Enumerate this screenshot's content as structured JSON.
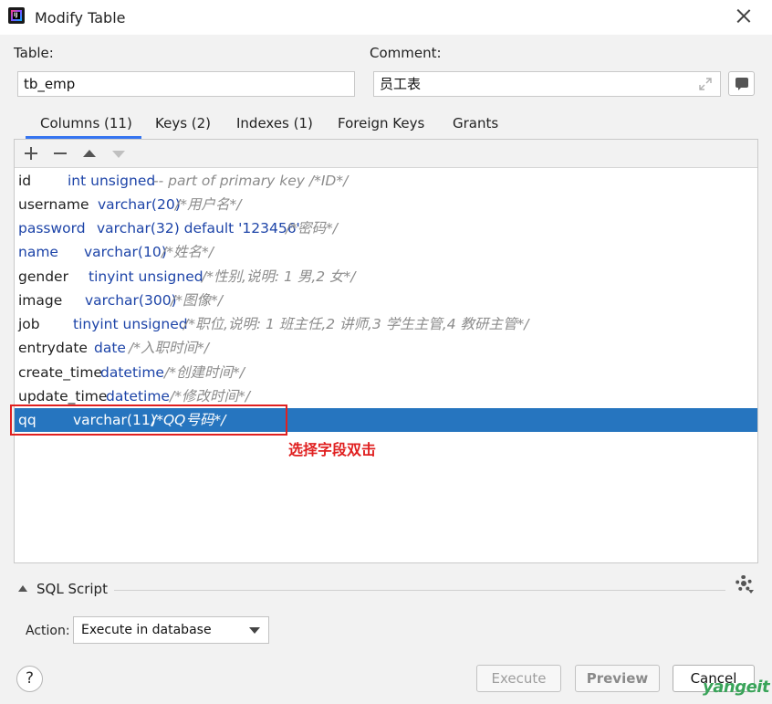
{
  "window": {
    "title": "Modify Table"
  },
  "form": {
    "table_label": "Table:",
    "table_value": "tb_emp",
    "comment_label": "Comment:",
    "comment_value": "员工表"
  },
  "tabs": [
    {
      "label": "Columns (11)",
      "active": true
    },
    {
      "label": "Keys (2)"
    },
    {
      "label": "Indexes (1)"
    },
    {
      "label": "Foreign Keys"
    },
    {
      "label": "Grants"
    }
  ],
  "columns": [
    {
      "name": "id",
      "type": "int unsigned",
      "comment": "-- part of primary key /*ID*/"
    },
    {
      "name": "username",
      "type": "varchar(20)",
      "comment": "/*用户名*/"
    },
    {
      "name": "password",
      "type": "varchar(32) default '123456'",
      "comment": "/*密码*/"
    },
    {
      "name": "name",
      "type": "varchar(10)",
      "comment": "/*姓名*/"
    },
    {
      "name": "gender",
      "type": "tinyint unsigned",
      "comment": "/*性别,说明: 1 男,2 女*/"
    },
    {
      "name": "image",
      "type": "varchar(300)",
      "comment": "/*图像*/"
    },
    {
      "name": "job",
      "type": "tinyint unsigned",
      "comment": "/*职位,说明: 1 班主任,2 讲师,3 学生主管,4 教研主管*/"
    },
    {
      "name": "entrydate",
      "type": "date",
      "comment": "/*入职时间*/"
    },
    {
      "name": "create_time",
      "type": "datetime",
      "comment": "/*创建时间*/"
    },
    {
      "name": "update_time",
      "type": "datetime",
      "comment": "/*修改时间*/"
    },
    {
      "name": "qq",
      "type": "varchar(11)",
      "comment": "/*QQ号码*/",
      "selected": true
    }
  ],
  "annotation": "选择字段双击",
  "sql_script": {
    "label": "SQL Script"
  },
  "action": {
    "label": "Action:",
    "value": "Execute in database"
  },
  "buttons": {
    "help": "?",
    "execute": "Execute",
    "preview": "Preview",
    "cancel": "Cancel"
  },
  "watermark": "yangeit",
  "colors": {
    "accent": "#3574f0",
    "selection": "#2675bf",
    "annotation": "#e02020"
  }
}
